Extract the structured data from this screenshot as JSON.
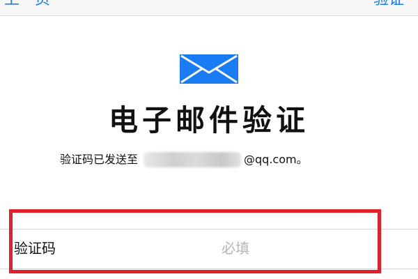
{
  "nav": {
    "back_label": "上一页",
    "next_label": "验证"
  },
  "icon": {
    "name": "mail-icon",
    "color": "#1a7cf5"
  },
  "page_title": "电子邮件验证",
  "sent_notice": {
    "prefix": "验证码已发送至",
    "email_suffix": "@qq.com。"
  },
  "code_field": {
    "label": "验证码",
    "placeholder": "必填",
    "value": ""
  },
  "colors": {
    "accent": "#1a7cf5",
    "highlight": "#e0202a"
  }
}
